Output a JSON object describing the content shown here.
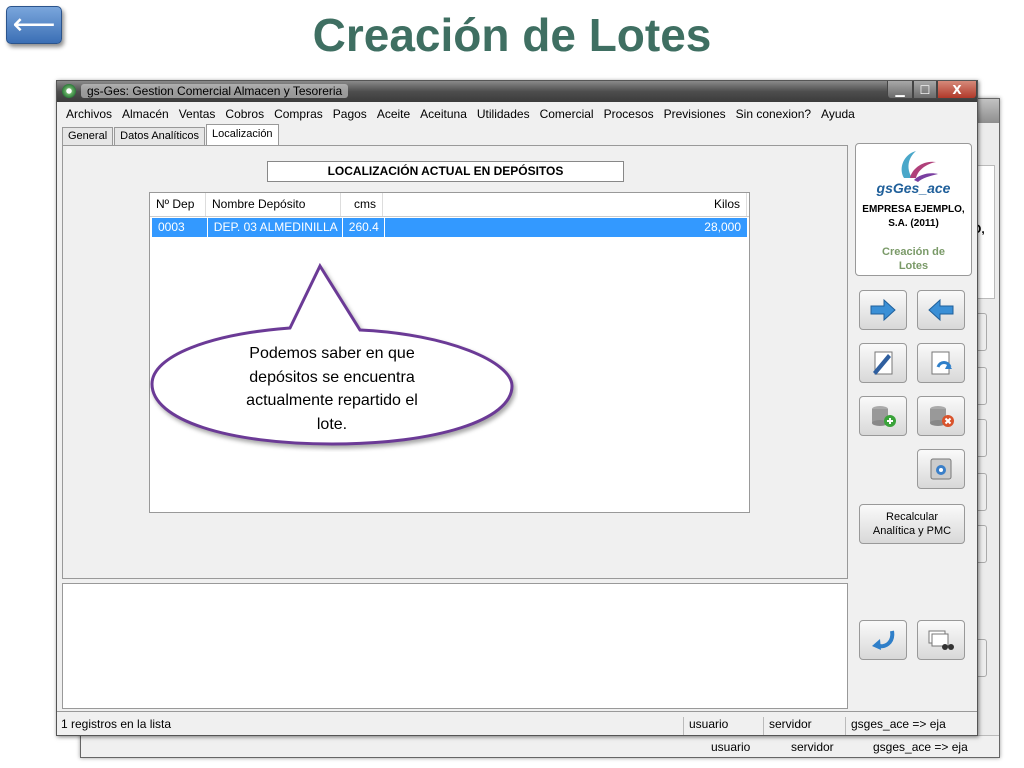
{
  "slide": {
    "back_arrow": "⟵",
    "title": "Creación de Lotes"
  },
  "window": {
    "title": "gs-Ges: Gestion Comercial Almacen y Tesoreria",
    "close_glyph": "X"
  },
  "menu": [
    "Archivos",
    "Almacén",
    "Ventas",
    "Cobros",
    "Compras",
    "Pagos",
    "Aceite",
    "Aceituna",
    "Utilidades",
    "Comercial",
    "Procesos",
    "Previsiones",
    "Sin conexion?",
    "Ayuda"
  ],
  "tabs": [
    "General",
    "Datos Analíticos",
    "Localización"
  ],
  "section": {
    "title": "LOCALIZACIÓN ACTUAL EN DEPÓSITOS"
  },
  "table": {
    "headers": [
      "Nº Dep",
      "Nombre Depósito",
      "cms",
      "Kilos"
    ],
    "rows": [
      [
        "0003",
        "DEP. 03 ALMEDINILLA",
        "260.4",
        "28,000"
      ]
    ]
  },
  "callout": {
    "text": "Podemos saber en que depósitos se encuentra actualmente repartido el lote."
  },
  "logo": {
    "name": "gsGes_ace",
    "company_line1": "EMPRESA EJEMPLO,",
    "company_line2": "S.A. (2011)",
    "module_line1": "Creación de",
    "module_line2": "Lotes"
  },
  "buttons": {
    "recalc_line1": "Recalcular",
    "recalc_line2": "Analítica y PMC"
  },
  "status": {
    "records": "1 registros en la lista",
    "user": "usuario",
    "server": "servidor",
    "db": "gsges_ace => eja"
  },
  "background_window": {
    "side_text": "O,",
    "user": "usuario",
    "server": "servidor",
    "db": "gsges_ace => eja"
  },
  "colors": {
    "title": "#3f6f62",
    "selection": "#3399ff",
    "callout_border": "#6b3a96",
    "logo_blue": "#1f5f9a",
    "module_green": "#7a9a68"
  },
  "icons": [
    "back-arrow-icon",
    "app-icon",
    "arrow-right-icon",
    "arrow-left-icon",
    "edit-document-icon",
    "undo-document-icon",
    "database-add-icon",
    "database-delete-icon",
    "disk-icon",
    "return-arrow-icon",
    "search-records-icon"
  ]
}
